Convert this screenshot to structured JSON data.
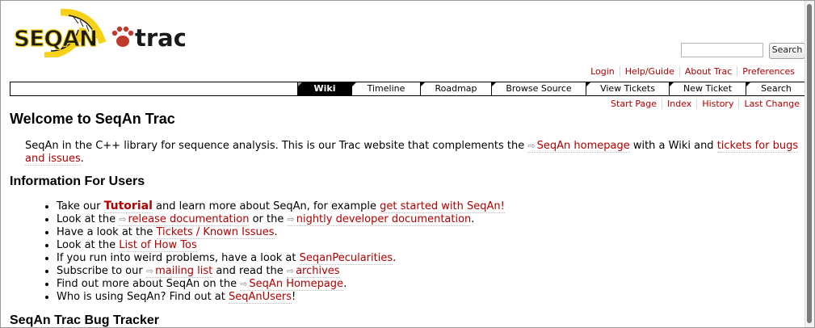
{
  "header": {
    "logo_text_left": "SEQAN",
    "logo_text_right": "trac",
    "logo_colors": {
      "left_text": "#1a1a1a",
      "yellow": "#f7d117",
      "paw": "#c0392b"
    },
    "search_placeholder": "",
    "search_button": "Search"
  },
  "metanav": [
    "Login",
    "Help/Guide",
    "About Trac",
    "Preferences"
  ],
  "mainnav": [
    {
      "label": "Wiki",
      "active": true
    },
    {
      "label": "Timeline",
      "active": false
    },
    {
      "label": "Roadmap",
      "active": false
    },
    {
      "label": "Browse Source",
      "active": false
    },
    {
      "label": "View Tickets",
      "active": false
    },
    {
      "label": "New Ticket",
      "active": false
    },
    {
      "label": "Search",
      "active": false
    }
  ],
  "ctxtnav": [
    "Start Page",
    "Index",
    "History",
    "Last Change"
  ],
  "content": {
    "title": "Welcome to SeqAn Trac",
    "intro": {
      "text1": "SeqAn in the C++ library for sequence analysis. This is our Trac website that complements the ",
      "link1": "SeqAn homepage",
      "text2": " with a Wiki and ",
      "link2": "tickets for bugs and issues",
      "text3": "."
    },
    "users_heading": "Information For Users",
    "users": [
      {
        "parts": [
          {
            "t": "Take our "
          },
          {
            "l": "Tutorial",
            "strong": true
          },
          {
            "t": " and learn more about SeqAn, for example "
          },
          {
            "l": "get started with SeqAn!"
          }
        ]
      },
      {
        "parts": [
          {
            "t": "Look at the "
          },
          {
            "l": "release documentation",
            "ext": true
          },
          {
            "t": " or the "
          },
          {
            "l": "nightly developer documentation",
            "ext": true
          },
          {
            "t": "."
          }
        ]
      },
      {
        "parts": [
          {
            "t": "Have a look at the "
          },
          {
            "l": "Tickets / Known Issues"
          },
          {
            "t": "."
          }
        ]
      },
      {
        "parts": [
          {
            "t": "Look at the "
          },
          {
            "l": "List of How Tos"
          }
        ]
      },
      {
        "parts": [
          {
            "t": "If you run into weird problems, have a look at "
          },
          {
            "l": "SeqanPecularities"
          },
          {
            "t": "."
          }
        ]
      },
      {
        "parts": [
          {
            "t": "Subscribe to our "
          },
          {
            "l": "mailing list",
            "ext": true
          },
          {
            "t": " and read the "
          },
          {
            "l": "archives",
            "ext": true
          }
        ]
      },
      {
        "parts": [
          {
            "t": "Find out more about SeqAn on the "
          },
          {
            "l": "SeqAn Homepage",
            "ext": true
          },
          {
            "t": "."
          }
        ]
      },
      {
        "parts": [
          {
            "t": "Who is using SeqAn? Find out at "
          },
          {
            "l": "SeqAnUsers"
          },
          {
            "t": "!"
          }
        ]
      }
    ],
    "bugs_heading": "SeqAn Trac Bug Tracker"
  },
  "colors": {
    "link": "#b00000",
    "nav_active_bg": "#000000"
  }
}
